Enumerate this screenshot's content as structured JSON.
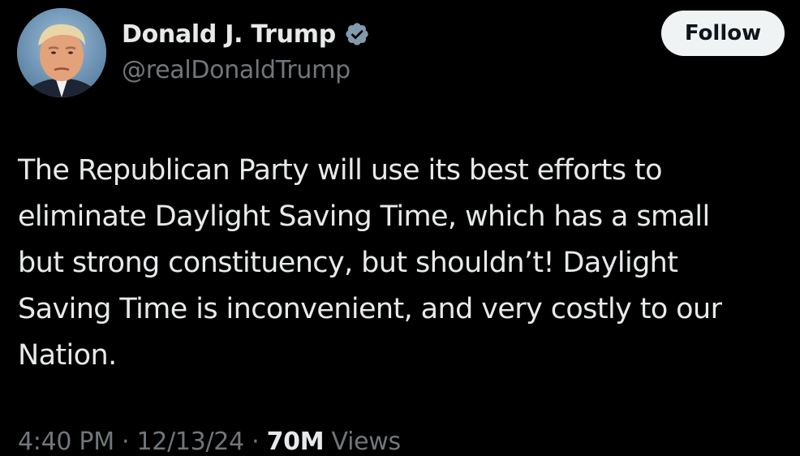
{
  "author": {
    "display_name": "Donald J. Trump",
    "handle": "@realDonaldTrump",
    "verified_icon": "verified-badge-icon",
    "avatar_icon": "avatar-photo"
  },
  "actions": {
    "follow_label": "Follow"
  },
  "post": {
    "text": "The Republican Party will use its best efforts to\neliminate Daylight Saving Time, which has a small\nbut strong constituency, but shouldn’t! Daylight\nSaving Time is inconvenient, and very costly to our\nNation."
  },
  "meta": {
    "time": "4:40 PM",
    "separator": " · ",
    "date": "12/13/24",
    "views_count": "70M",
    "views_label": " Views"
  },
  "colors": {
    "background": "#000000",
    "primary_text": "#e7e9ea",
    "secondary_text": "#71767b",
    "follow_button_bg": "#eff3f4",
    "verified_badge": "#829aab"
  }
}
